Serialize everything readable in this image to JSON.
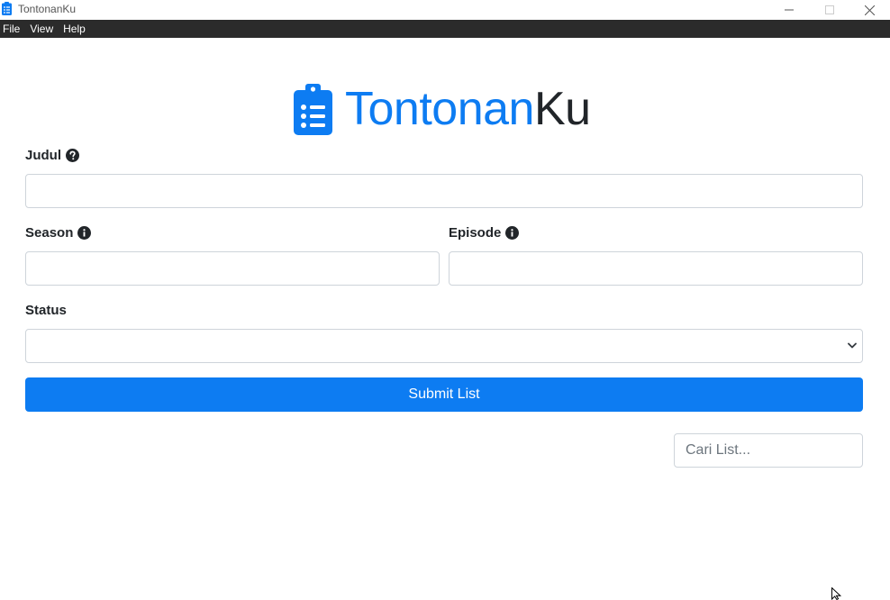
{
  "window": {
    "title": "TontonanKu"
  },
  "menu": {
    "items": [
      "File",
      "View",
      "Help"
    ]
  },
  "logo": {
    "part1": "Tontonan",
    "part2": "Ku",
    "accent": "#0d7cf2"
  },
  "form": {
    "judul_label": "Judul",
    "judul_value": "",
    "season_label": "Season",
    "season_value": "",
    "episode_label": "Episode",
    "episode_value": "",
    "status_label": "Status",
    "status_value": "",
    "submit_label": "Submit List"
  },
  "search": {
    "placeholder": "Cari List..."
  },
  "icons": {
    "app": "clipboard-list-icon",
    "judul_help": "question-circle-icon",
    "season_info": "info-circle-icon",
    "episode_info": "info-circle-icon"
  }
}
